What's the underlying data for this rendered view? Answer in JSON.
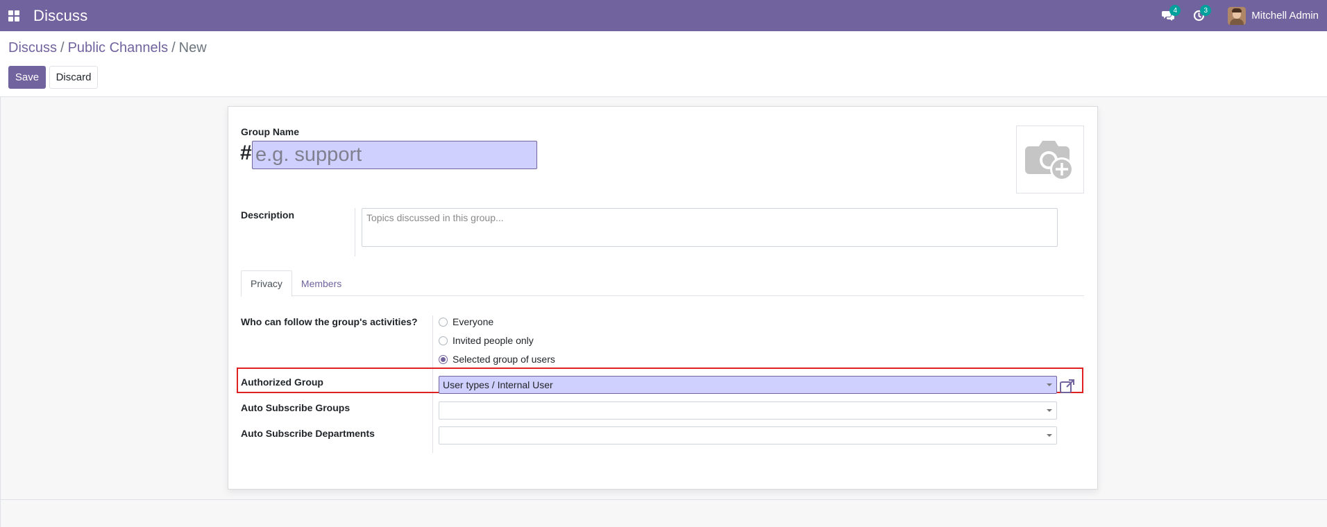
{
  "navbar": {
    "app_name": "Discuss",
    "messages_badge": "4",
    "activities_badge": "3",
    "user_name": "Mitchell Admin"
  },
  "breadcrumb": {
    "items": [
      "Discuss",
      "Public Channels"
    ],
    "current": "New"
  },
  "buttons": {
    "save": "Save",
    "discard": "Discard"
  },
  "form": {
    "group_name_label": "Group Name",
    "hash": "#",
    "group_name_placeholder": "e.g. support",
    "description_label": "Description",
    "description_placeholder": "Topics discussed in this group...",
    "tabs": [
      {
        "label": "Privacy",
        "active": true
      },
      {
        "label": "Members",
        "active": false
      }
    ],
    "privacy": {
      "follow_label": "Who can follow the group's activities?",
      "options": [
        {
          "label": "Everyone",
          "checked": false
        },
        {
          "label": "Invited people only",
          "checked": false
        },
        {
          "label": "Selected group of users",
          "checked": true
        }
      ],
      "authorized_group_label": "Authorized Group",
      "authorized_group_value": "User types / Internal User",
      "auto_subscribe_groups_label": "Auto Subscribe Groups",
      "auto_subscribe_groups_value": "",
      "auto_subscribe_departments_label": "Auto Subscribe Departments",
      "auto_subscribe_departments_value": ""
    }
  },
  "icons": {
    "apps": "apps-grid-icon",
    "messages": "chat-bubbles-icon",
    "activities": "clock-icon",
    "image": "camera-plus-icon",
    "external": "external-link-icon"
  },
  "colors": {
    "brand": "#71639e",
    "badge": "#00a09d",
    "highlight_border": "#e02020",
    "input_fill": "#d0d0ff"
  }
}
